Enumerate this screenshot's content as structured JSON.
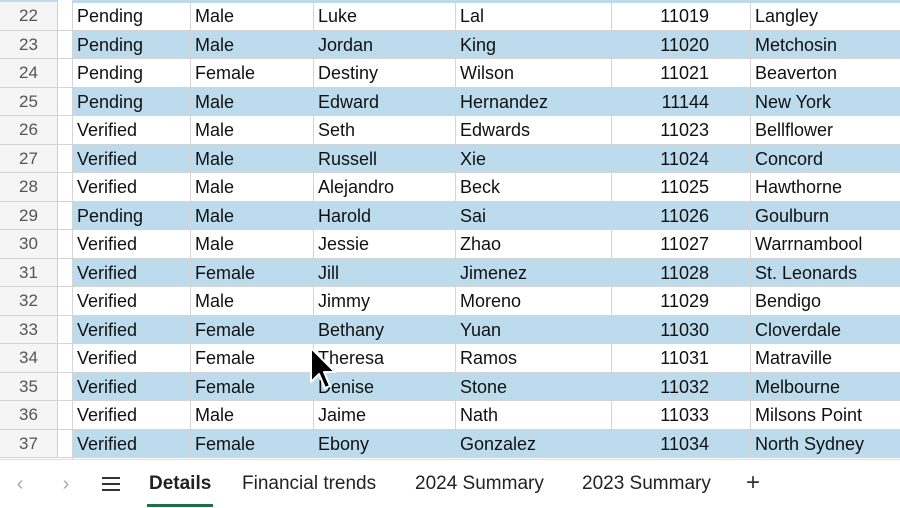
{
  "rows": [
    {
      "num": "22",
      "status": "Pending",
      "gender": "Male",
      "first": "Luke",
      "last": "Lal",
      "id": "11019",
      "city": "Langley"
    },
    {
      "num": "23",
      "status": "Pending",
      "gender": "Male",
      "first": "Jordan",
      "last": "King",
      "id": "11020",
      "city": "Metchosin"
    },
    {
      "num": "24",
      "status": "Pending",
      "gender": "Female",
      "first": "Destiny",
      "last": "Wilson",
      "id": "11021",
      "city": "Beaverton"
    },
    {
      "num": "25",
      "status": "Pending",
      "gender": "Male",
      "first": "Edward",
      "last": "Hernandez",
      "id": "11144",
      "city": "New York"
    },
    {
      "num": "26",
      "status": "Verified",
      "gender": "Male",
      "first": "Seth",
      "last": "Edwards",
      "id": "11023",
      "city": "Bellflower"
    },
    {
      "num": "27",
      "status": "Verified",
      "gender": "Male",
      "first": "Russell",
      "last": "Xie",
      "id": "11024",
      "city": "Concord"
    },
    {
      "num": "28",
      "status": "Verified",
      "gender": "Male",
      "first": "Alejandro",
      "last": "Beck",
      "id": "11025",
      "city": "Hawthorne"
    },
    {
      "num": "29",
      "status": "Pending",
      "gender": "Male",
      "first": "Harold",
      "last": "Sai",
      "id": "11026",
      "city": "Goulburn"
    },
    {
      "num": "30",
      "status": "Verified",
      "gender": "Male",
      "first": "Jessie",
      "last": "Zhao",
      "id": "11027",
      "city": "Warrnambool"
    },
    {
      "num": "31",
      "status": "Verified",
      "gender": "Female",
      "first": "Jill",
      "last": "Jimenez",
      "id": "11028",
      "city": "St. Leonards"
    },
    {
      "num": "32",
      "status": "Verified",
      "gender": "Male",
      "first": "Jimmy",
      "last": "Moreno",
      "id": "11029",
      "city": "Bendigo"
    },
    {
      "num": "33",
      "status": "Verified",
      "gender": "Female",
      "first": "Bethany",
      "last": "Yuan",
      "id": "11030",
      "city": "Cloverdale"
    },
    {
      "num": "34",
      "status": "Verified",
      "gender": "Female",
      "first": "Theresa",
      "last": "Ramos",
      "id": "11031",
      "city": "Matraville"
    },
    {
      "num": "35",
      "status": "Verified",
      "gender": "Female",
      "first": "Denise",
      "last": "Stone",
      "id": "11032",
      "city": "Melbourne"
    },
    {
      "num": "36",
      "status": "Verified",
      "gender": "Male",
      "first": "Jaime",
      "last": "Nath",
      "id": "11033",
      "city": "Milsons Point"
    },
    {
      "num": "37",
      "status": "Verified",
      "gender": "Female",
      "first": "Ebony",
      "last": "Gonzalez",
      "id": "11034",
      "city": "North Sydney"
    }
  ],
  "tabs": [
    {
      "label": "Details",
      "active": true
    },
    {
      "label": "Financial trends",
      "active": false
    },
    {
      "label": "2024 Summary",
      "active": false
    },
    {
      "label": "2023 Summary",
      "active": false
    }
  ],
  "icons": {
    "prev": "chevron-left-icon",
    "next": "chevron-right-icon",
    "menu": "hamburger-menu-icon",
    "add": "plus-icon",
    "cursor": "mouse-pointer-icon"
  },
  "colors": {
    "stripe": "#bcdcee",
    "active_tab_underline": "#1e7145"
  }
}
